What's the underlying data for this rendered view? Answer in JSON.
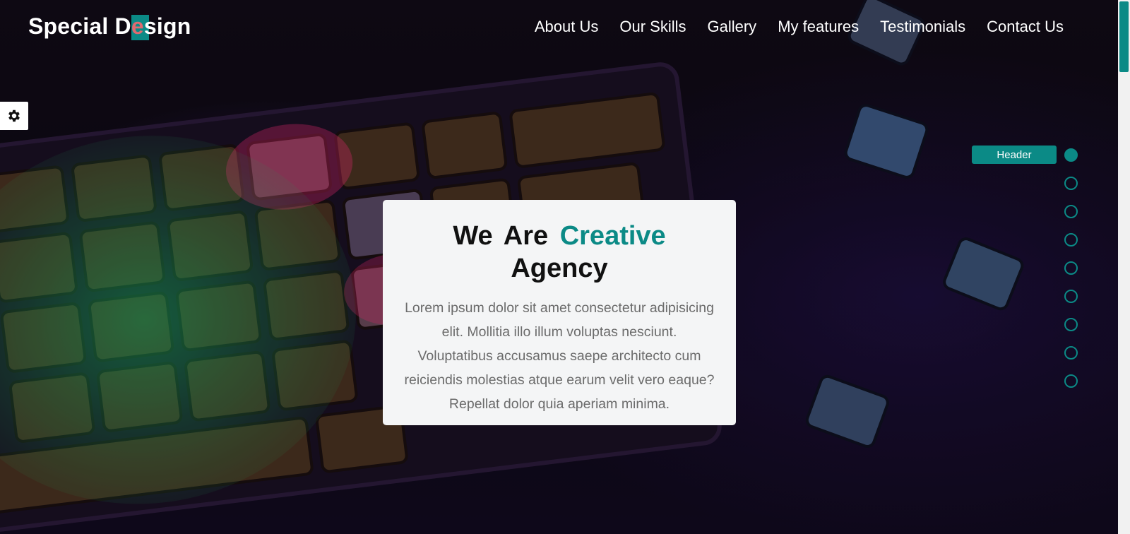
{
  "header": {
    "logo_before": "Special D",
    "logo_accent": "e",
    "logo_after": "sign",
    "nav": [
      "About Us",
      "Our Skills",
      "Gallery",
      "My features",
      "Testimonials",
      "Contact Us"
    ]
  },
  "settings": {
    "icon": "gear-icon"
  },
  "hero": {
    "title_before": "We Are",
    "title_highlight": "Creative",
    "title_after": "Agency",
    "text": "Lorem ipsum dolor sit amet consectetur adipisicing elit. Mollitia illo illum voluptas nesciunt. Voluptatibus accusamus saepe architecto cum reiciendis molestias atque earum velit vero eaque? Repellat dolor quia aperiam minima."
  },
  "bullets": {
    "active_label": "Header",
    "count": 9
  },
  "colors": {
    "accent": "#0b8a86",
    "logo_accent": "#e06a70"
  }
}
